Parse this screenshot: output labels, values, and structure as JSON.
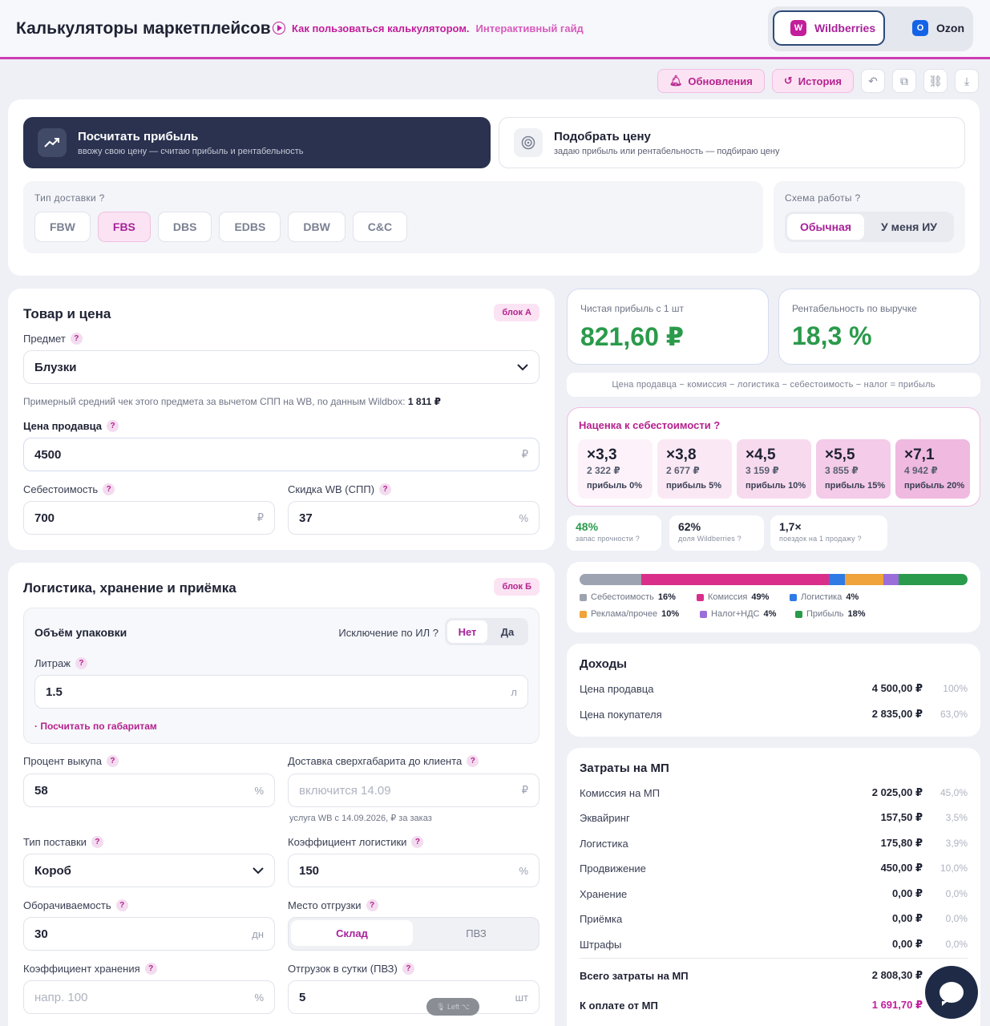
{
  "header": {
    "title": "Калькуляторы маркетплейсов",
    "guide_main": "Как пользоваться калькулятором.",
    "guide_sub": "Интерактивный гайд",
    "marketplaces": [
      {
        "label": "Wildberries",
        "logo": "W",
        "color": "#c21d9b",
        "active": true
      },
      {
        "label": "Ozon",
        "logo": "O",
        "color": "#1463e6",
        "active": false
      }
    ]
  },
  "toolbar": {
    "updates": "Обновления",
    "history": "История"
  },
  "modes": [
    {
      "title": "Посчитать прибыль",
      "subtitle": "ввожу свою цену — считаю прибыль и рентабельность",
      "active": true
    },
    {
      "title": "Подобрать цену",
      "subtitle": "задаю прибыль или рентабельность — подбираю цену",
      "active": false
    }
  ],
  "delivery": {
    "label": "Тип доставки ?",
    "options": [
      "FBW",
      "FBS",
      "DBS",
      "EDBS",
      "DBW",
      "C&C"
    ],
    "selected": "FBS"
  },
  "scheme": {
    "label": "Схема работы ?",
    "options": [
      "Обычная",
      "У меня ИУ"
    ],
    "selected": "Обычная"
  },
  "product": {
    "title": "Товар и цена",
    "badge": "блок А",
    "subject_label": "Предмет",
    "subject_value": "Блузки",
    "avg_note": "Примерный средний чек этого предмета за вычетом СПП на WB, по данным Wildbox:",
    "avg_value": "1 811 ₽",
    "price_label": "Цена продавца",
    "price_value": "4500",
    "cost_label": "Себестоимость",
    "cost_value": "700",
    "discount_label": "Скидка WB (СПП)",
    "discount_value": "37",
    "currency": "₽",
    "percent": "%"
  },
  "logistics": {
    "title": "Логистика, хранение и приёмка",
    "badge": "блок Б",
    "pack_title": "Объём упаковки",
    "il_label": "Исключение по ИЛ ?",
    "il_options": [
      "Нет",
      "Да"
    ],
    "litre_label": "Литраж",
    "litre_value": "1.5",
    "litre_unit": "л",
    "calc_link": "Посчитать по габаритам",
    "buyout_label": "Процент выкупа",
    "buyout_value": "58",
    "oversize_label": "Доставка сверхгабарита до клиента",
    "oversize_placeholder": "включится 14.09",
    "oversize_note": "услуга WB с 14.09.2026, ₽ за заказ",
    "supply_label": "Тип поставки",
    "supply_value": "Короб",
    "logcoef_label": "Коэффициент логистики",
    "logcoef_value": "150",
    "turnover_label": "Оборачиваемость",
    "turnover_value": "30",
    "turnover_unit": "дн",
    "ship_label": "Место отгрузки",
    "ship_options": [
      "Склад",
      "ПВЗ"
    ],
    "storecoef_label": "Коэффициент хранения",
    "storecoef_placeholder": "напр. 100",
    "daily_label": "Отгрузок в сутки (ПВЗ)",
    "daily_value": "5",
    "daily_unit": "шт"
  },
  "kpi": {
    "profit_label": "Чистая прибыль с 1 шт",
    "profit_value": "821,60 ₽",
    "margin_label": "Рентабельность по выручке",
    "margin_value": "18,3 %",
    "formula": "Цена продавца − комиссия − логистика − себестоимость − налог = прибыль"
  },
  "markup": {
    "title": "Наценка к себестоимости ?",
    "tiles": [
      {
        "mult": "×3,3",
        "price": "2 322 ₽",
        "profit": "прибыль 0%",
        "bg": "#fdf2fa"
      },
      {
        "mult": "×3,8",
        "price": "2 677 ₽",
        "profit": "прибыль 5%",
        "bg": "#fbe8f5"
      },
      {
        "mult": "×4,5",
        "price": "3 159 ₽",
        "profit": "прибыль 10%",
        "bg": "#f8daef"
      },
      {
        "mult": "×5,5",
        "price": "3 855 ₽",
        "profit": "прибыль 15%",
        "bg": "#f4cbe8"
      },
      {
        "mult": "×7,1",
        "price": "4 942 ₽",
        "profit": "прибыль 20%",
        "bg": "#efb9e0"
      }
    ]
  },
  "stats": [
    {
      "value": "48%",
      "desc": "запас прочности ?",
      "color": "#2a9a4b"
    },
    {
      "value": "62%",
      "desc": "доля Wildberries ?",
      "color": "#1e2233"
    },
    {
      "value": "1,7×",
      "desc": "поездок на 1 продажу ?",
      "color": "#1e2233"
    }
  ],
  "structure": [
    {
      "name": "Себестоимость",
      "pct": "16%",
      "share": 16,
      "color": "#9ea3b1"
    },
    {
      "name": "Комиссия",
      "pct": "49%",
      "share": 49,
      "color": "#d92f8a"
    },
    {
      "name": "Логистика",
      "pct": "4%",
      "share": 4,
      "color": "#2f7ae5"
    },
    {
      "name": "Реклама/прочее",
      "pct": "10%",
      "share": 10,
      "color": "#f0a33a"
    },
    {
      "name": "Налог+НДС",
      "pct": "4%",
      "share": 4,
      "color": "#9a6ddb"
    },
    {
      "name": "Прибыль",
      "pct": "18%",
      "share": 18,
      "color": "#2a9a4b"
    }
  ],
  "income": {
    "title": "Доходы",
    "rows": [
      {
        "label": "Цена продавца",
        "value": "4 500,00 ₽",
        "pct": "100%"
      },
      {
        "label": "Цена покупателя",
        "value": "2 835,00 ₽",
        "pct": "63,0%"
      }
    ]
  },
  "costs": {
    "title": "Затраты на МП",
    "rows": [
      {
        "label": "Комиссия на МП",
        "value": "2 025,00 ₽",
        "pct": "45,0%"
      },
      {
        "label": "Эквайринг",
        "value": "157,50 ₽",
        "pct": "3,5%"
      },
      {
        "label": "Логистика",
        "value": "175,80 ₽",
        "pct": "3,9%"
      },
      {
        "label": "Продвижение",
        "value": "450,00 ₽",
        "pct": "10,0%"
      },
      {
        "label": "Хранение",
        "value": "0,00 ₽",
        "pct": "0,0%"
      },
      {
        "label": "Приёмка",
        "value": "0,00 ₽",
        "pct": "0,0%"
      },
      {
        "label": "Штрафы",
        "value": "0,00 ₽",
        "pct": "0,0%"
      }
    ],
    "total_label": "Всего затраты на МП",
    "total_value": "2 808,30 ₽",
    "pay_label": "К оплате от МП",
    "pay_value": "1 691,70 ₽"
  },
  "overlay": {
    "pill": "🎙 Left ⌥"
  }
}
